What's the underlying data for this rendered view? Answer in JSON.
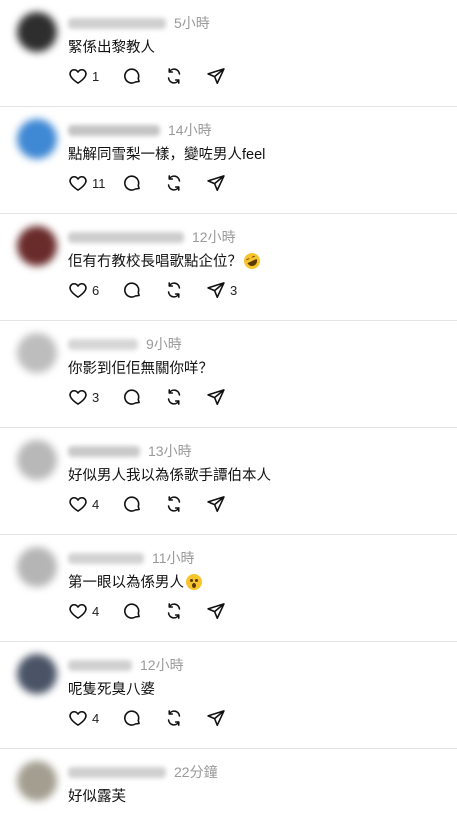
{
  "posts": [
    {
      "time": "5小時",
      "text": "緊係出黎教人",
      "likes": "1",
      "reposts": "",
      "shares": "",
      "emoji": "",
      "avatar_color": "#2e2e2e",
      "username_color": "#cfcfcf",
      "username_w": "98"
    },
    {
      "time": "14小時",
      "text": "點解同雪梨一樣，變咗男人feel",
      "likes": "11",
      "reposts": "",
      "shares": "",
      "emoji": "",
      "avatar_color": "#3f88d4",
      "username_color": "#c4c4c4",
      "username_w": "92"
    },
    {
      "time": "12小時",
      "text": "佢有冇教校長唱歌點企位？",
      "likes": "6",
      "reposts": "",
      "shares": "3",
      "emoji": "laugh",
      "avatar_color": "#6a2b2b",
      "username_color": "#cdcdcd",
      "username_w": "116"
    },
    {
      "time": "9小時",
      "text": "你影到佢佢無關你咩？",
      "likes": "3",
      "reposts": "",
      "shares": "",
      "emoji": "",
      "avatar_color": "#bdbdbd",
      "username_color": "#d6d6d6",
      "username_w": "70"
    },
    {
      "time": "13小時",
      "text": "好似男人我以為係歌手譚伯本人",
      "likes": "4",
      "reposts": "",
      "shares": "",
      "emoji": "",
      "avatar_color": "#b8b8b8",
      "username_color": "#c9c9c9",
      "username_w": "72"
    },
    {
      "time": "11小時",
      "text": "第一眼以為係男人",
      "likes": "4",
      "reposts": "",
      "shares": "",
      "emoji": "shock",
      "avatar_color": "#b5b5b5",
      "username_color": "#d2d2d2",
      "username_w": "76"
    },
    {
      "time": "12小時",
      "text": "呢隻死臭八婆",
      "likes": "4",
      "reposts": "",
      "shares": "",
      "emoji": "",
      "avatar_color": "#4a5466",
      "username_color": "#d0d0d0",
      "username_w": "64"
    },
    {
      "time": "22分鐘",
      "text": "好似露芙",
      "likes": "",
      "reposts": "",
      "shares": "",
      "emoji": "",
      "avatar_color": "#a39e90",
      "username_color": "#cfcfcf",
      "username_w": "98"
    }
  ]
}
